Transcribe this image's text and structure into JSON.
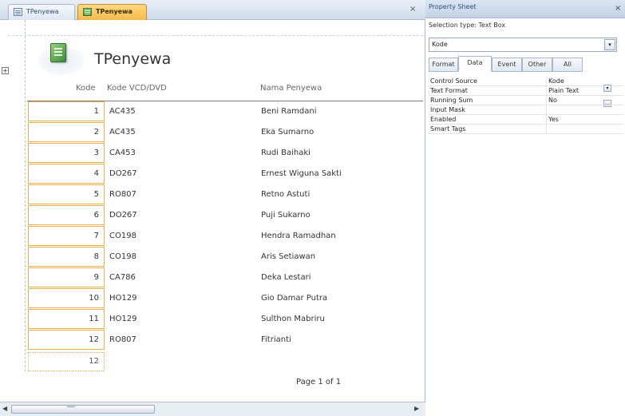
{
  "tabs": [
    {
      "label": "TPenyewa",
      "kind": "table",
      "active": false
    },
    {
      "label": "TPenyewa",
      "kind": "report",
      "active": true
    }
  ],
  "report": {
    "title": "TPenyewa",
    "headers": {
      "kode": "Kode",
      "vcd": "Kode VCD/DVD",
      "nama": "Nama Penyewa"
    },
    "rows": [
      {
        "kode": "1",
        "vcd": "AC435",
        "nama": "Beni Ramdani"
      },
      {
        "kode": "2",
        "vcd": "AC435",
        "nama": "Eka Sumarno"
      },
      {
        "kode": "3",
        "vcd": "CA453",
        "nama": "Rudi Baihaki"
      },
      {
        "kode": "4",
        "vcd": "DO267",
        "nama": "Ernest Wiguna Sakti"
      },
      {
        "kode": "5",
        "vcd": "RO807",
        "nama": "Retno Astuti"
      },
      {
        "kode": "6",
        "vcd": "DO267",
        "nama": "Puji Sukarno"
      },
      {
        "kode": "7",
        "vcd": "CO198",
        "nama": "Hendra Ramadhan"
      },
      {
        "kode": "8",
        "vcd": "CO198",
        "nama": "Aris Setiawan"
      },
      {
        "kode": "9",
        "vcd": "CA786",
        "nama": "Deka Lestari"
      },
      {
        "kode": "10",
        "vcd": "HO129",
        "nama": "Gio Damar Putra"
      },
      {
        "kode": "11",
        "vcd": "HO129",
        "nama": "Sulthon Mabriru"
      },
      {
        "kode": "12",
        "vcd": "RO807",
        "nama": "Fitrianti"
      }
    ],
    "total": "12",
    "page_label": "Page 1 of 1"
  },
  "property_sheet": {
    "title": "Property Sheet",
    "selection_type": "Selection type:  Text Box",
    "selected_control": "Kode",
    "tabs": [
      {
        "label": "Format",
        "active": false
      },
      {
        "label": "Data",
        "active": true
      },
      {
        "label": "Event",
        "active": false
      },
      {
        "label": "Other",
        "active": false
      },
      {
        "label": "All",
        "active": false
      }
    ],
    "properties": [
      {
        "name": "Control Source",
        "value": "Kode"
      },
      {
        "name": "Text Format",
        "value": "Plain Text"
      },
      {
        "name": "Running Sum",
        "value": "No"
      },
      {
        "name": "Input Mask",
        "value": ""
      },
      {
        "name": "Enabled",
        "value": "Yes"
      },
      {
        "name": "Smart Tags",
        "value": ""
      }
    ]
  },
  "icons": {
    "close": "×",
    "dropdown": "▾",
    "ellipsis": "…",
    "move": "+",
    "scroll_left": "◀",
    "scroll_right": "▶"
  },
  "colors": {
    "active_tab": "#f5b94a",
    "field_border": "#e8b04a",
    "panel_border": "#a9b8cc"
  }
}
